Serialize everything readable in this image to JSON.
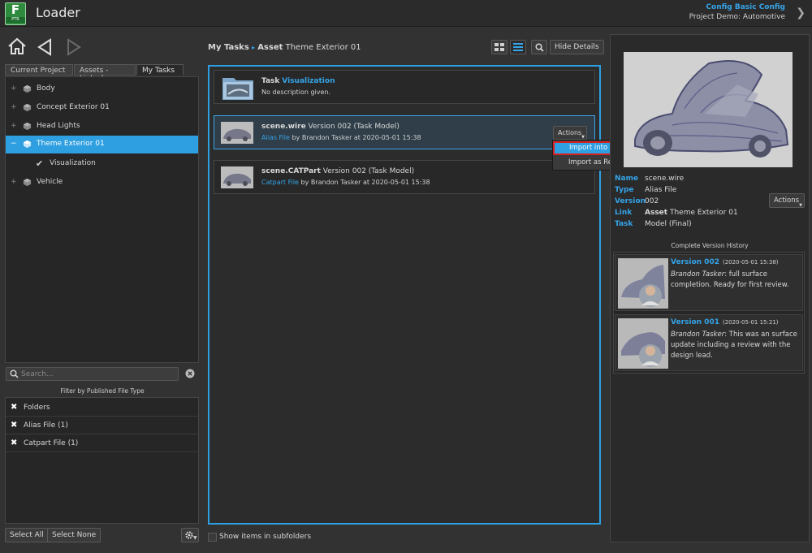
{
  "app": {
    "logo_letter": "F",
    "logo_sub": "PTR",
    "title": "Loader",
    "config": "Config Basic Config",
    "project": "Project Demo: Automotive"
  },
  "tabs": [
    {
      "label": "Current Project"
    },
    {
      "label": "Assets - Linked"
    },
    {
      "label": "My Tasks"
    }
  ],
  "tree": {
    "items": [
      {
        "label": "Body",
        "expander": "+"
      },
      {
        "label": "Concept Exterior 01",
        "expander": "+"
      },
      {
        "label": "Head Lights",
        "expander": "+"
      },
      {
        "label": "Theme Exterior 01",
        "expander": "−",
        "selected": true
      },
      {
        "label": "Visualization",
        "check": "✔"
      },
      {
        "label": "Vehicle",
        "expander": "+"
      }
    ]
  },
  "search": {
    "placeholder": "Search..."
  },
  "filter": {
    "title": "Filter by Published File Type",
    "items": [
      {
        "label": "Folders",
        "mark": "✖"
      },
      {
        "label": "Alias File (1)",
        "mark": "✖"
      },
      {
        "label": "Catpart File (1)",
        "mark": "✖"
      }
    ]
  },
  "buttons": {
    "select_all": "Select All",
    "select_none": "Select None",
    "hide_details": "Hide Details",
    "actions": "Actions"
  },
  "breadcrumb": {
    "root": "My Tasks",
    "sep": "▸",
    "entity_type": "Asset",
    "entity_name": "Theme Exterior 01"
  },
  "files": [
    {
      "title_prefix": "Task",
      "title_link": "Visualization",
      "subtitle": "No description given."
    },
    {
      "name": "scene.wire",
      "version": "Version 002 (Task Model)",
      "type": "Alias File",
      "by": "by Brandon Tasker at 2020-05-01 15:38"
    },
    {
      "name": "scene.CATPart",
      "version": "Version 002 (Task Model)",
      "type": "Catpart File",
      "by": "by Brandon Tasker at 2020-05-01 15:38"
    }
  ],
  "context_menu": {
    "import_scene": "Import into Scene",
    "import_ref": "Import as Reference"
  },
  "subfolders_label": "Show items in subfolders",
  "details": {
    "name_key": "Name",
    "name": "scene.wire",
    "type_key": "Type",
    "type": "Alias File",
    "version_key": "Version",
    "version": "002",
    "link_key": "Link",
    "link_type": "Asset",
    "link_name": "Theme Exterior 01",
    "task_key": "Task",
    "task": "Model (Final)"
  },
  "history": {
    "title": "Complete Version History",
    "items": [
      {
        "version": "Version 002",
        "date": "(2020-05-01 15:38)",
        "author": "Brandon Tasker",
        "desc": ": full surface completion. Ready for first review."
      },
      {
        "version": "Version 001",
        "date": "(2020-05-01 15:21)",
        "author": "Brandon Tasker",
        "desc": ": This was an surface update including a review with the design lead."
      }
    ]
  },
  "colors": {
    "accent": "#2e9fe0",
    "link": "#35a4e8",
    "highlight_border": "#d81f1f",
    "logo_green": "#2e8b3e"
  }
}
